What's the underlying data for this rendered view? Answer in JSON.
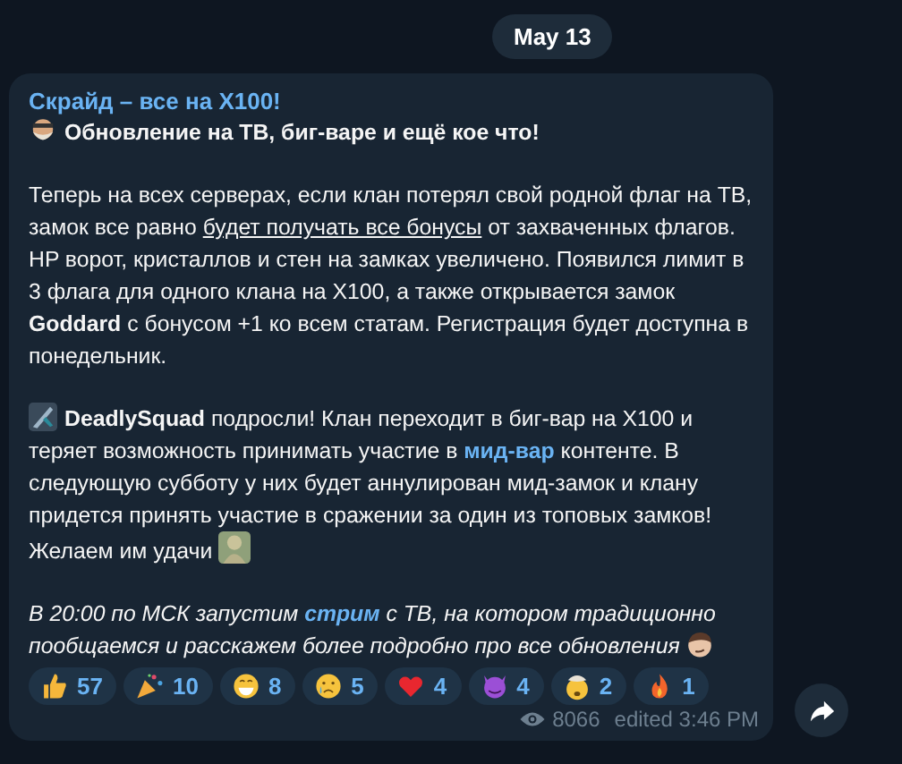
{
  "date_pill": "May 13",
  "message": {
    "title": "Скрайд – все на X100!",
    "paragraphs": [
      {
        "italic": false,
        "segments": [
          {
            "kind": "face"
          },
          {
            "kind": "bold",
            "text": "Обновление на ТВ, биг-варе и ещё кое что!"
          }
        ]
      },
      {
        "italic": false,
        "segments": [
          {
            "kind": "text",
            "text": "Теперь на всех серверах, если клан потерял свой родной флаг на ТВ, замок все равно "
          },
          {
            "kind": "underline",
            "text": "будет получать все бонусы"
          },
          {
            "kind": "text",
            "text": " от захваченных флагов. HP ворот, кристаллов и стен на замках увеличено. Появился лимит в 3 флага для одного клана на X100, а также открывается замок **Goddard** с бонусом +1 ко всем статам. Регистрация будет доступна в понедельник."
          }
        ]
      },
      {
        "italic": false,
        "segments": [
          {
            "kind": "blade"
          },
          {
            "kind": "text",
            "text": "**DeadlySquad** подросли! Клан переходит в биг-вар на X100 и теряет возможность принимать участие в "
          },
          {
            "kind": "link",
            "text": "мид-вар"
          },
          {
            "kind": "text",
            "text": " контенте. В следующую субботу у них будет аннулирован мид-замок и клану придется принять участие в сражении за один из топовых замков! Желаем им удачи "
          },
          {
            "kind": "figure"
          }
        ]
      },
      {
        "italic": true,
        "segments": [
          {
            "kind": "text",
            "text": "В 20:00 по МСК запустим "
          },
          {
            "kind": "link",
            "text": "стрим"
          },
          {
            "kind": "text",
            "text": " с ТВ, на котором традиционно пообщаемся и расскажем более подробно про все обновления "
          },
          {
            "kind": "smirk"
          }
        ]
      }
    ],
    "reactions": [
      {
        "kind": "thumbs",
        "count": "57"
      },
      {
        "kind": "party",
        "count": "10"
      },
      {
        "kind": "grin",
        "count": "8"
      },
      {
        "kind": "cry",
        "count": "5"
      },
      {
        "kind": "heart",
        "count": "4"
      },
      {
        "kind": "devil",
        "count": "4"
      },
      {
        "kind": "exploding",
        "count": "2"
      },
      {
        "kind": "fire",
        "count": "1"
      }
    ],
    "views": "8066",
    "edited": "edited 3:46 PM"
  }
}
